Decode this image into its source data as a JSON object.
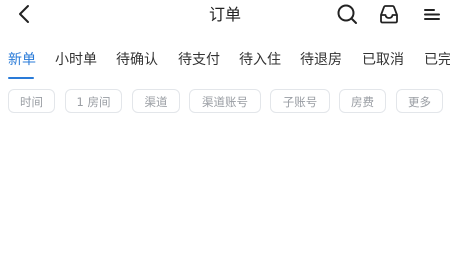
{
  "header": {
    "title": "订单",
    "back_icon": "chevron-left-icon",
    "search_icon": "search-icon",
    "inbox_icon": "inbox-icon",
    "menu_icon": "menu-icon"
  },
  "tabs": {
    "items": [
      {
        "label": "新单",
        "active": true
      },
      {
        "label": "小时单",
        "active": false
      },
      {
        "label": "待确认",
        "active": false
      },
      {
        "label": "待支付",
        "active": false
      },
      {
        "label": "待入住",
        "active": false
      },
      {
        "label": "待退房",
        "active": false
      },
      {
        "label": "已取消",
        "active": false
      },
      {
        "label": "已完",
        "active": false
      }
    ]
  },
  "filters": {
    "chips": [
      {
        "label": "时间"
      },
      {
        "label": "1 房间"
      },
      {
        "label": "渠道"
      },
      {
        "label": "渠道账号"
      },
      {
        "label": "子账号"
      },
      {
        "label": "房费"
      },
      {
        "label": "更多"
      }
    ]
  },
  "colors": {
    "accent": "#2a7bd8",
    "text": "#222222",
    "chip_text": "#999da3",
    "chip_border": "#e3e6ea"
  }
}
